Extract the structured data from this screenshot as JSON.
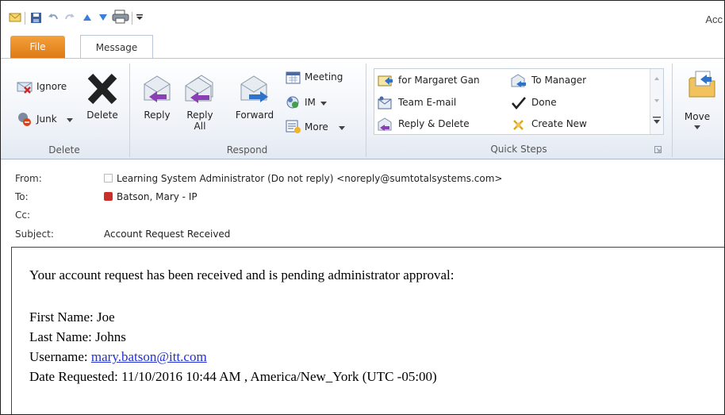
{
  "window": {
    "title_partial": "Acc"
  },
  "tabs": [
    {
      "label": "File"
    },
    {
      "label": "Message"
    }
  ],
  "ribbon": {
    "delete_group": {
      "label": "Delete",
      "ignore": "Ignore",
      "junk": "Junk",
      "delete": "Delete"
    },
    "respond_group": {
      "label": "Respond",
      "reply": "Reply",
      "reply_all_1": "Reply",
      "reply_all_2": "All",
      "forward": "Forward",
      "meeting": "Meeting",
      "im": "IM",
      "more": "More"
    },
    "quick_steps": {
      "label": "Quick Steps",
      "items": [
        "for Margaret Gan",
        "To Manager",
        "Team E-mail",
        "Done",
        "Reply & Delete",
        "Create New"
      ]
    },
    "move_group": {
      "move": "Move"
    }
  },
  "header": {
    "from_label": "From:",
    "from_value": "Learning System Administrator (Do not reply) <noreply@sumtotalsystems.com>",
    "to_label": "To:",
    "to_value": "Batson, Mary - IP",
    "cc_label": "Cc:",
    "cc_value": "",
    "subject_label": "Subject:",
    "subject_value": "Account Request Received"
  },
  "body": {
    "intro": "Your account request has been received and is pending administrator approval:",
    "first_name": "First Name: Joe",
    "last_name": "Last Name: Johns",
    "username_label": "Username: ",
    "username_value": "mary.batson@itt.com",
    "date_requested": "Date Requested: 11/10/2016 10:44 AM , America/New_York (UTC -05:00)"
  },
  "colors": {
    "file_tab": "#e8891f",
    "link": "#1f2fd3",
    "ribbon_bg": "#eef2f8"
  }
}
